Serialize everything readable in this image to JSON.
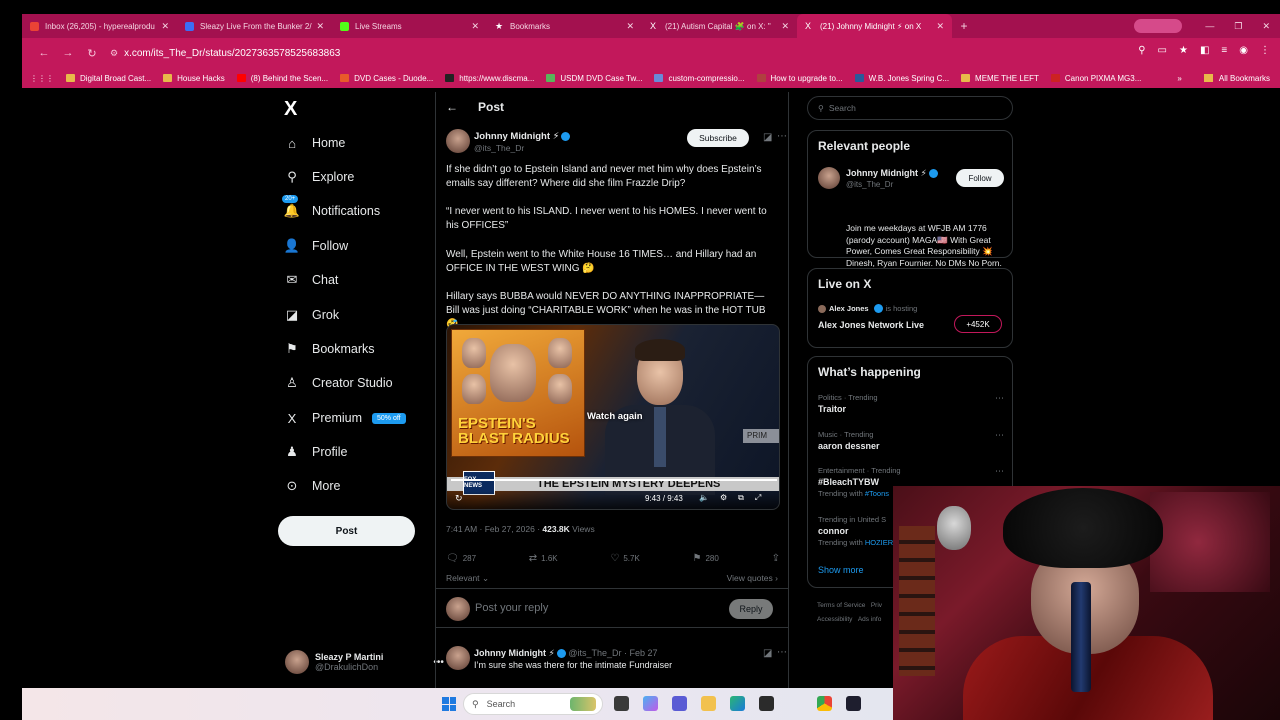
{
  "browser": {
    "tabs": [
      {
        "title": "Inbox (26,205) - hyperealprodu",
        "color": "#ea4335",
        "active": false
      },
      {
        "title": "Sleazy Live From the Bunker 2/",
        "color": "#3b6ef5",
        "active": false
      },
      {
        "title": "Live Streams",
        "color": "#53fc18",
        "active": false
      },
      {
        "title": "Bookmarks",
        "color": "#ffffff",
        "active": false
      },
      {
        "title": "(21) Autism Capital 🧩 on X: \"",
        "color": "#ffffff",
        "active": false
      },
      {
        "title": "(21) Johnny Midnight ⚡ on X",
        "color": "#ffffff",
        "active": true
      }
    ],
    "new_tab_label": "+",
    "url": "x.com/its_The_Dr/status/2027363578525683863",
    "bookmarks": [
      {
        "label": "Digital Broad Cast...",
        "color": "#e8b94a"
      },
      {
        "label": "House Hacks",
        "color": "#e8b94a"
      },
      {
        "label": "(8) Behind the Scen...",
        "color": "#ff0000"
      },
      {
        "label": "DVD Cases - Duode...",
        "color": "#e85a2a"
      },
      {
        "label": "https://www.discma...",
        "color": "#222222"
      },
      {
        "label": "USDM DVD Case Tw...",
        "color": "#5ab55a"
      },
      {
        "label": "custom-compressio...",
        "color": "#6a8ad8"
      },
      {
        "label": "How to upgrade to...",
        "color": "#b04040"
      },
      {
        "label": "W.B. Jones Spring C...",
        "color": "#2a5a9a"
      },
      {
        "label": "MEME THE LEFT",
        "color": "#e8b94a"
      },
      {
        "label": "Canon PIXMA MG3...",
        "color": "#cc2222"
      }
    ],
    "all_bookmarks_label": "All Bookmarks"
  },
  "nav": {
    "logo": "X",
    "items": [
      {
        "label": "Home",
        "icon": "home-icon",
        "glyph": "⌂"
      },
      {
        "label": "Explore",
        "icon": "search-icon",
        "glyph": "⚲"
      },
      {
        "label": "Notifications",
        "icon": "bell-icon",
        "glyph": "🔔"
      },
      {
        "label": "Follow",
        "icon": "follow-icon",
        "glyph": "👤"
      },
      {
        "label": "Chat",
        "icon": "chat-icon",
        "glyph": "✉"
      },
      {
        "label": "Grok",
        "icon": "grok-icon",
        "glyph": "◪"
      },
      {
        "label": "Bookmarks",
        "icon": "bookmark-icon",
        "glyph": "🔖"
      },
      {
        "label": "Creator Studio",
        "icon": "creator-studio-icon",
        "glyph": "♙"
      },
      {
        "label": "Premium",
        "icon": "premium-icon",
        "glyph": "X"
      },
      {
        "label": "Profile",
        "icon": "profile-icon",
        "glyph": "👤"
      },
      {
        "label": "More",
        "icon": "more-icon",
        "glyph": "⋯"
      }
    ],
    "notifications_badge": "20+",
    "premium_badge": "50% off",
    "post_button": "Post",
    "account": {
      "name": "Sleazy P Martini",
      "handle": "@DrakulichDon"
    }
  },
  "post": {
    "header_title": "Post",
    "author_name": "Johnny Midnight ⚡",
    "author_handle": "@its_The_Dr",
    "subscribe_label": "Subscribe",
    "paragraphs": [
      "If she didn’t go to Epstein Island and never met him why does Epstein’s emails say different? Where did she film Frazzle Drip?",
      "“I never went to his ISLAND. I never went to his HOMES. I never went to his OFFICES”",
      "Well, Epstein went to the White House 16 TIMES… and Hillary had an OFFICE IN THE WEST WING 🤔",
      "Hillary says BUBBA would NEVER DO ANYTHING INAPPROPRIATE— Bill was just doing “CHARITABLE WORK” when he was in the HOT TUB 🤣"
    ],
    "video": {
      "title_line": "EPSTEIN'S BLAST RADIUS",
      "watch_again": "Watch again",
      "banner": "THE EPSTEIN MYSTERY DEEPENS",
      "channel": "FOX NEWS",
      "corner_text": "PRIM",
      "time": "9:43 / 9:43",
      "progress": 1.0
    },
    "timestamp": "7:41 AM · Feb 27, 2026 · ",
    "views_count": "423.8K",
    "views_label": " Views",
    "stats": {
      "replies": "287",
      "reposts": "1.6K",
      "likes": "5.7K",
      "bookmarks": "280"
    },
    "relevant_label": "Relevant",
    "view_quotes_label": "View quotes",
    "reply_placeholder": "Post your reply",
    "reply_button": "Reply",
    "first_reply": {
      "name": "Johnny Midnight ⚡",
      "handle_date": "@its_The_Dr · Feb 27",
      "text": "I’m sure she was there for the intimate Fundraiser"
    }
  },
  "sidebar": {
    "search_placeholder": "Search",
    "relevant_people": {
      "title": "Relevant people",
      "name": "Johnny Midnight ⚡",
      "handle": "@its_The_Dr",
      "follow_label": "Follow",
      "bio": "Join me weekdays at WFJB AM 1776 (parody account) MAGA🇺🇸 With Great Power, Comes Great Responsibility 💥 Dinesh, Ryan Fournier. No DMs No Porn."
    },
    "live": {
      "title": "Live on X",
      "host": "Alex Jones",
      "hosting_label": "is hosting",
      "stream_title": "Alex Jones Network Live",
      "count": "+452K"
    },
    "happening": {
      "title": "What’s happening",
      "trends": [
        {
          "context": "Politics · Trending",
          "name": "Traitor",
          "with": "",
          "with_link": ""
        },
        {
          "context": "Music · Trending",
          "name": "aaron dessner",
          "with": "",
          "with_link": ""
        },
        {
          "context": "Entertainment · Trending",
          "name": "#BleachTYBW",
          "with": "Trending with ",
          "with_link": "#Toons"
        },
        {
          "context": "Trending in United S",
          "name": "connor",
          "with": "Trending with ",
          "with_link": "HOZIER"
        }
      ],
      "show_more": "Show more"
    },
    "footer": [
      "Terms of Service",
      "Priv",
      "Accessibility",
      "Ads info"
    ]
  },
  "taskbar": {
    "search_placeholder": "Search"
  }
}
